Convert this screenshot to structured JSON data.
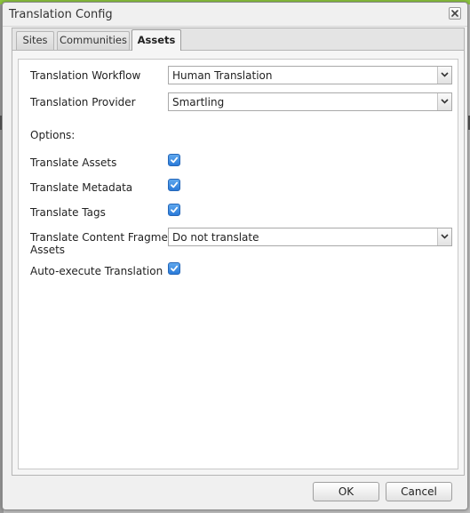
{
  "dialog": {
    "title": "Translation Config"
  },
  "tabs": [
    {
      "label": "Sites",
      "active": false
    },
    {
      "label": "Communities",
      "active": false
    },
    {
      "label": "Assets",
      "active": true
    }
  ],
  "form": {
    "workflow": {
      "label": "Translation Workflow",
      "value": "Human Translation"
    },
    "provider": {
      "label": "Translation Provider",
      "value": "Smartling"
    },
    "options_label": "Options:",
    "translate_assets": {
      "label": "Translate Assets",
      "checked": true
    },
    "translate_metadata": {
      "label": "Translate Metadata",
      "checked": true
    },
    "translate_tags": {
      "label": "Translate Tags",
      "checked": true
    },
    "content_fragment": {
      "label_line1": "Translate Content Fragment",
      "label_line2": "Assets",
      "value": "Do not translate"
    },
    "auto_execute": {
      "label": "Auto-execute Translation",
      "checked": true
    }
  },
  "footer": {
    "ok_label": "OK",
    "cancel_label": "Cancel"
  },
  "colors": {
    "accent_bar": "#8dc63f",
    "checkbox": "#2a7ad9"
  }
}
